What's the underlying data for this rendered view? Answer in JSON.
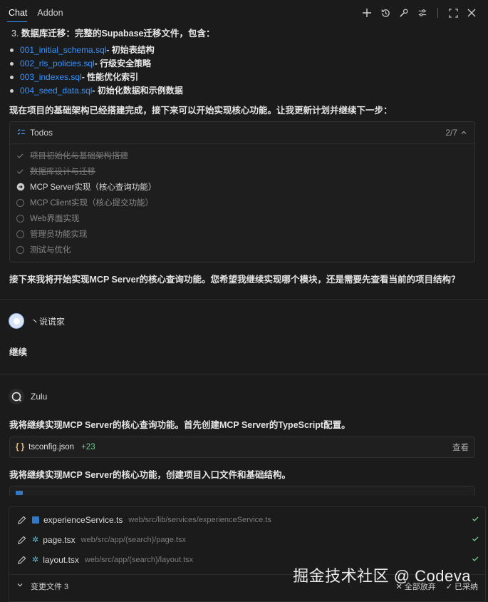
{
  "tabs": [
    {
      "label": "Chat"
    },
    {
      "label": "Addon"
    }
  ],
  "toolbar": {
    "icons": [
      "plus-icon",
      "history-icon",
      "wrench-icon",
      "sliders-icon",
      "expand-icon",
      "close-icon"
    ]
  },
  "message1": {
    "list_item": {
      "number": "3.",
      "title": "数据库迁移：",
      "text": "完整的Supabase迁移文件，包含："
    },
    "files": [
      {
        "name": "001_initial_schema.sql",
        "desc": " - 初始表结构"
      },
      {
        "name": "002_rls_policies.sql",
        "desc": " - 行级安全策略"
      },
      {
        "name": "003_indexes.sql",
        "desc": " - 性能优化索引"
      },
      {
        "name": "004_seed_data.sql",
        "desc": " - 初始化数据和示例数据"
      }
    ],
    "para": "现在项目的基础架构已经搭建完成，接下来可以开始实现核心功能。让我更新计划并继续下一步：",
    "todos": {
      "title": "Todos",
      "count": "2/7",
      "items": [
        {
          "text": "项目初始化与基础架构搭建",
          "state": "done"
        },
        {
          "text": "数据库设计与迁移",
          "state": "done"
        },
        {
          "text": "MCP Server实现（核心查询功能）",
          "state": "active"
        },
        {
          "text": "MCP Client实现（核心提交功能）",
          "state": "pending"
        },
        {
          "text": "Web界面实现",
          "state": "pending"
        },
        {
          "text": "管理员功能实现",
          "state": "pending"
        },
        {
          "text": "测试与优化",
          "state": "pending"
        }
      ]
    },
    "closing": "接下来我将开始实现MCP Server的核心查询功能。您希望我继续实现哪个模块，还是需要先查看当前的项目结构？"
  },
  "user_message": {
    "name": "丶说谎家",
    "text": "继续"
  },
  "assistant": {
    "name": "Zulu",
    "text1": "我将继续实现MCP Server的核心查询功能。首先创建MCP Server的TypeScript配置。",
    "card": {
      "filename": "tsconfig.json",
      "added": "+23",
      "view": "查看"
    },
    "text2": "我将继续实现MCP Server的核心功能，创建项目入口文件和基础结构。"
  },
  "changes_panel": {
    "files": [
      {
        "name": "experienceService.ts",
        "path": "web/src/lib/services/experienceService.ts",
        "type": "ts"
      },
      {
        "name": "page.tsx",
        "path": "web/src/app/(search)/page.tsx",
        "type": "tsx"
      },
      {
        "name": "layout.tsx",
        "path": "web/src/app/(search)/layout.tsx",
        "type": "tsx"
      }
    ],
    "footer_label": "变更文件 3",
    "reject_all": "全部放弃",
    "accepted": "已采纳"
  },
  "watermark": "掘金技术社区 @ Codeva"
}
